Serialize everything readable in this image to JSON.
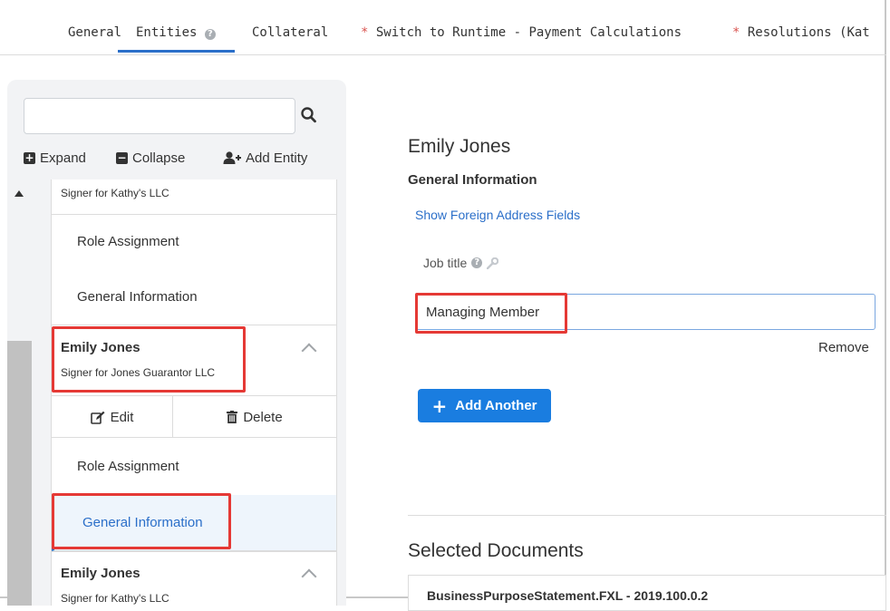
{
  "tabs": [
    {
      "label": "General",
      "required": false
    },
    {
      "label": "Entities",
      "required": false,
      "active": true
    },
    {
      "label": "Collateral",
      "required": false
    },
    {
      "label": "Switch to Runtime - Payment Calculations",
      "required": true
    },
    {
      "label": "Resolutions (Kat",
      "required": true
    }
  ],
  "sidebar": {
    "search": {
      "value": "",
      "placeholder": ""
    },
    "toolbar": {
      "expand": "Expand",
      "collapse": "Collapse",
      "add_entity": "Add Entity"
    },
    "tree": {
      "entity0_subtitle": "Signer for Kathy's LLC",
      "entity0_items": [
        "Role Assignment",
        "General Information"
      ],
      "entity1_name": "Emily Jones",
      "entity1_subtitle": "Signer for Jones Guarantor LLC",
      "edit": "Edit",
      "delete": "Delete",
      "entity1_items": [
        "Role Assignment",
        "General Information"
      ],
      "entity2_name": "Emily Jones",
      "entity2_subtitle": "Signer for Kathy's LLC"
    }
  },
  "main": {
    "title": "Emily Jones",
    "section": "General Information",
    "foreign_link": "Show Foreign Address Fields",
    "job_title_label": "Job title",
    "job_title_value": "Managing Member",
    "remove": "Remove",
    "add_another": "Add Another",
    "selected_documents_title": "Selected Documents",
    "document_name": "BusinessPurposeStatement.FXL - 2019.100.0.2"
  },
  "colors": {
    "accent": "#1a7de0",
    "link": "#2b6fc9",
    "highlight": "#e53935",
    "required": "#d9534f"
  }
}
